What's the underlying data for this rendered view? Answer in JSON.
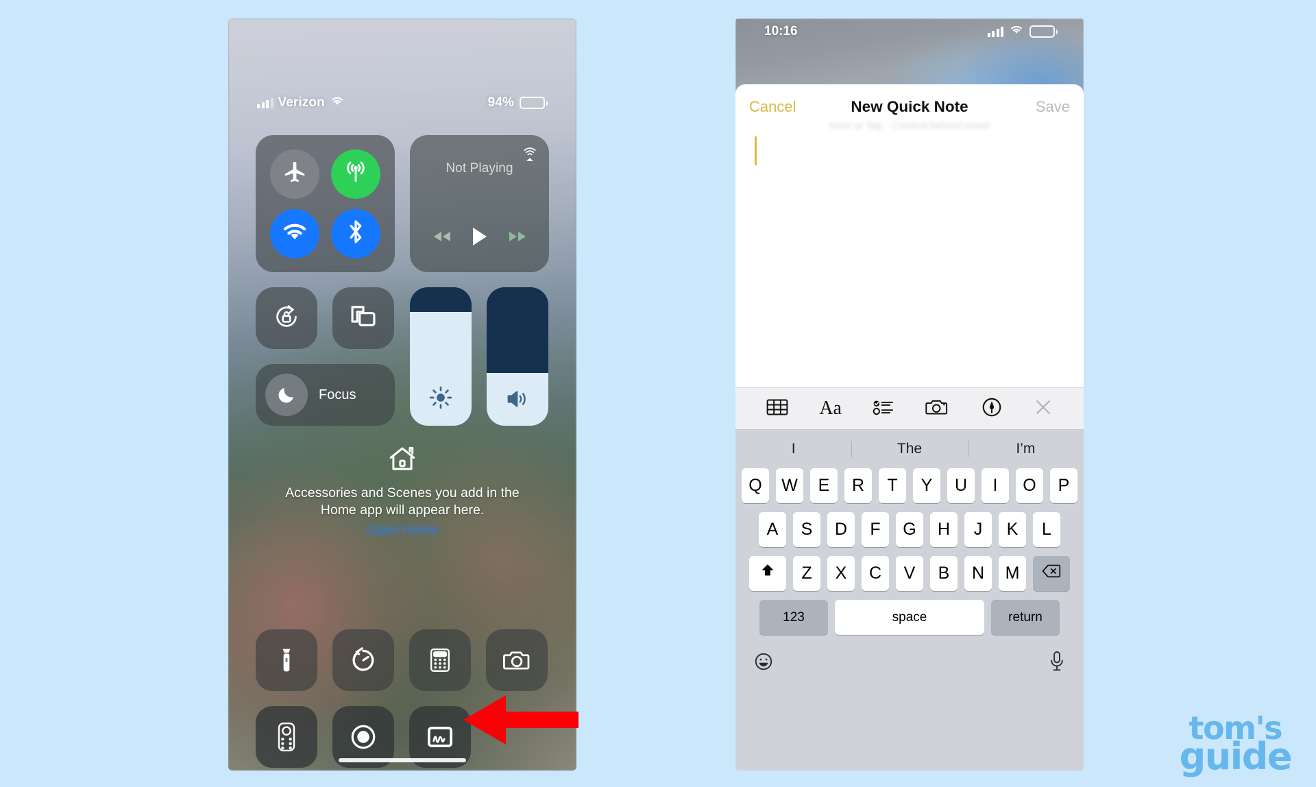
{
  "page": {
    "background_color": "#cbe7fb",
    "watermark": {
      "line1": "tom's",
      "line2": "guide",
      "color": "#66b7ec"
    }
  },
  "left_phone": {
    "name": "iOS Control Center",
    "status_bar": {
      "carrier": "Verizon",
      "battery_percent": "94%",
      "battery_level": 94,
      "signal_icon": "cellular-bars-icon",
      "wifi_icon": "wifi-icon",
      "battery_icon": "battery-icon"
    },
    "connectivity_tile": {
      "buttons": [
        {
          "name": "airplane-mode",
          "icon": "airplane-icon",
          "state": "off",
          "color": "#80848a"
        },
        {
          "name": "cellular-data",
          "icon": "cellular-antenna-icon",
          "state": "on",
          "color": "#2ed058"
        },
        {
          "name": "wifi",
          "icon": "wifi-icon",
          "state": "on",
          "color": "#1677ff"
        },
        {
          "name": "bluetooth",
          "icon": "bluetooth-icon",
          "state": "on",
          "color": "#1677ff"
        }
      ]
    },
    "media_tile": {
      "title": "Not Playing",
      "airplay_icon": "airplay-audio-icon",
      "controls": [
        "rewind-icon",
        "play-icon",
        "fast-forward-icon"
      ]
    },
    "mini_tiles": [
      {
        "name": "rotation-lock",
        "icon": "rotation-lock-icon"
      },
      {
        "name": "screen-mirroring",
        "icon": "screen-mirroring-icon"
      }
    ],
    "focus_tile": {
      "label": "Focus",
      "icon": "moon-icon"
    },
    "sliders": [
      {
        "name": "brightness-slider",
        "icon": "brightness-icon",
        "value": 82
      },
      {
        "name": "volume-slider",
        "icon": "volume-icon",
        "value": 38
      }
    ],
    "home_block": {
      "icon": "home-house-icon",
      "text_line1": "Accessories and Scenes you add in the",
      "text_line2": "Home app will appear here.",
      "link": "Open Home"
    },
    "dock": [
      {
        "name": "flashlight",
        "icon": "flashlight-icon"
      },
      {
        "name": "timer",
        "icon": "timer-icon"
      },
      {
        "name": "calculator",
        "icon": "calculator-icon"
      },
      {
        "name": "camera",
        "icon": "camera-icon"
      },
      {
        "name": "apple-tv-remote",
        "icon": "remote-icon"
      },
      {
        "name": "screen-record",
        "icon": "record-icon"
      },
      {
        "name": "quick-note",
        "icon": "quick-note-icon"
      }
    ],
    "annotation": {
      "arrow": "red-left-arrow",
      "points_at": "quick-note",
      "color": "#ff0000"
    }
  },
  "right_phone": {
    "name": "New Quick Note sheet",
    "status_bar": {
      "time": "10:16",
      "signal_icon": "cellular-bars-icon",
      "wifi_icon": "wifi-icon",
      "battery_icon": "battery-icon"
    },
    "note_header": {
      "cancel": "Cancel",
      "title": "New Quick Note",
      "save": "Save",
      "save_enabled": false,
      "cancel_color": "#d8b84a"
    },
    "note_body": {
      "text": "",
      "caret_color": "#e0b93b"
    },
    "toolbar": [
      {
        "name": "table-button",
        "icon": "table-icon"
      },
      {
        "name": "format-button",
        "icon": "aa-format-icon",
        "label": "Aa"
      },
      {
        "name": "checklist-button",
        "icon": "checklist-icon"
      },
      {
        "name": "camera-button",
        "icon": "camera-icon"
      },
      {
        "name": "markup-button",
        "icon": "markup-pen-icon"
      },
      {
        "name": "close-button",
        "icon": "close-x-icon"
      }
    ],
    "keyboard": {
      "predictions": [
        "I",
        "The",
        "I’m"
      ],
      "row1": [
        "Q",
        "W",
        "E",
        "R",
        "T",
        "Y",
        "U",
        "I",
        "O",
        "P"
      ],
      "row2": [
        "A",
        "S",
        "D",
        "F",
        "G",
        "H",
        "J",
        "K",
        "L"
      ],
      "row3": [
        "Z",
        "X",
        "C",
        "V",
        "B",
        "N",
        "M"
      ],
      "shift_icon": "shift-arrow-icon",
      "backspace_icon": "backspace-icon",
      "numbers_key": "123",
      "space_key": "space",
      "return_key": "return",
      "emoji_icon": "emoji-smiley-icon",
      "dictation_icon": "microphone-icon"
    }
  }
}
